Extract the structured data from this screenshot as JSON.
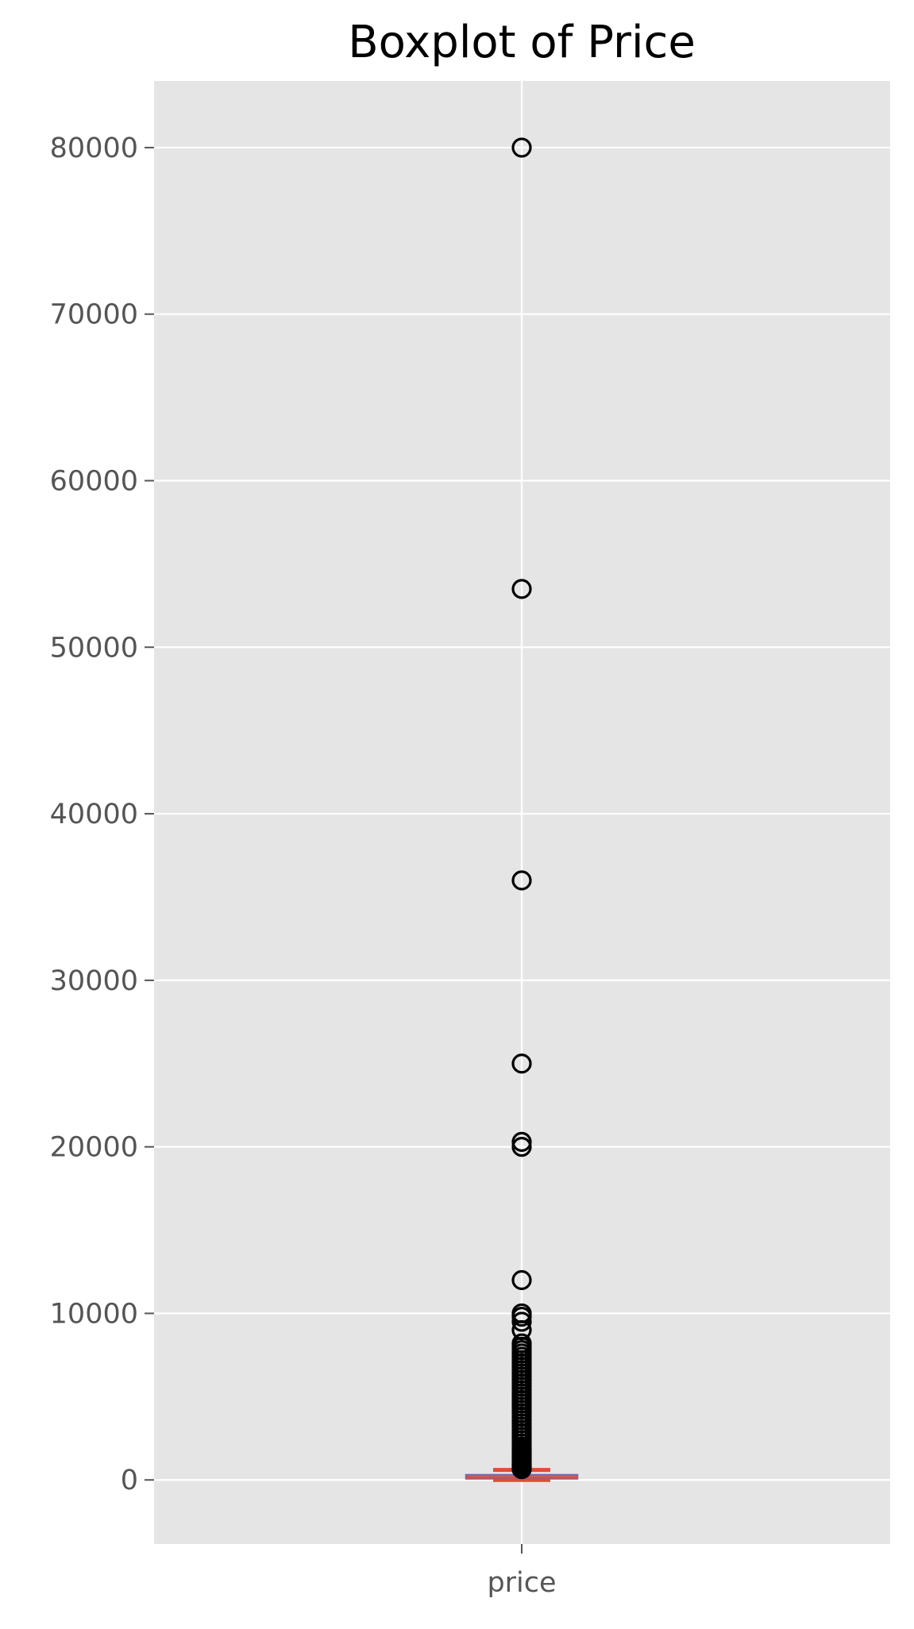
{
  "chart_data": {
    "type": "box",
    "title": "Boxplot of Price",
    "xlabel": "",
    "ylabel": "",
    "categories": [
      "price"
    ],
    "ylim": [
      -3850,
      84000
    ],
    "yticks": [
      0,
      10000,
      20000,
      30000,
      40000,
      50000,
      60000,
      70000,
      80000
    ],
    "ytick_labels": [
      "0",
      "10000",
      "20000",
      "30000",
      "40000",
      "50000",
      "60000",
      "70000",
      "80000"
    ],
    "grid": true,
    "box": {
      "q1": 80,
      "median": 155,
      "q3": 300,
      "whisker_low": 0,
      "whisker_high": 600
    },
    "outliers": [
      80000,
      53500,
      36000,
      25000,
      20300,
      20000,
      12000,
      10000,
      9800,
      9500,
      9000,
      8200,
      8000,
      7800,
      7600,
      7400,
      7200,
      7000,
      6800,
      6600,
      6400,
      6200,
      6000,
      5800,
      5600,
      5400,
      5200,
      5000,
      4800,
      4600,
      4400,
      4200,
      4000,
      3800,
      3600,
      3400,
      3200,
      3000,
      2800,
      2600,
      2400,
      2200,
      2000,
      1900,
      1800,
      1700,
      1600,
      1500,
      1400,
      1300,
      1200,
      1100,
      1000,
      950,
      900,
      850,
      800,
      750,
      700,
      650
    ],
    "colors": {
      "background": "#e5e5e5",
      "grid": "#ffffff",
      "box": "#7a68a6",
      "median": "#e24a33",
      "whisker": "#e24a33",
      "outlier_edge": "#000000",
      "tick_label": "#555555",
      "title": "#000000"
    }
  }
}
